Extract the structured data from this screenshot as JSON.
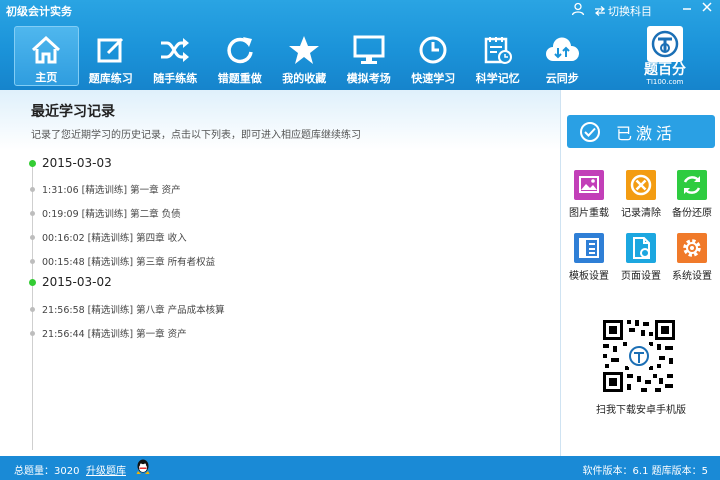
{
  "titlebar": {
    "app_title": "初级会计实务",
    "switch_subject": "切换科目",
    "user_icon": "user-icon",
    "buttons": [
      "minimize-icon",
      "close-icon"
    ]
  },
  "nav": {
    "active_color": "#3aa9e8",
    "items": [
      {
        "label": "主页",
        "icon": "home-icon"
      },
      {
        "label": "题库练习",
        "icon": "edit-icon"
      },
      {
        "label": "随手练练",
        "icon": "shuffle-icon"
      },
      {
        "label": "错题重做",
        "icon": "refresh-icon"
      },
      {
        "label": "我的收藏",
        "icon": "star-icon"
      },
      {
        "label": "模拟考场",
        "icon": "monitor-icon"
      },
      {
        "label": "快速学习",
        "icon": "clock-icon"
      },
      {
        "label": "科学记忆",
        "icon": "calendar-icon"
      },
      {
        "label": "云同步",
        "icon": "cloud-sync-icon"
      }
    ]
  },
  "logo": {
    "name": "题百分",
    "sub": "TI100.com"
  },
  "main": {
    "title": "最近学习记录",
    "subtitle": "记录了您近期学习的历史记录，点击以下列表，即可进入相应题库继续练习",
    "groups": [
      {
        "date": "2015-03-03",
        "records": [
          "1:31:06 [精选训练] 第一章 资产",
          "0:19:09 [精选训练] 第二章 负债",
          "00:16:02 [精选训练] 第四章 收入",
          "00:15:48 [精选训练] 第三章 所有者权益"
        ]
      },
      {
        "date": "2015-03-02",
        "records": [
          "21:56:58 [精选训练] 第八章 产品成本核算",
          "21:56:44 [精选训练] 第一章 资产"
        ]
      }
    ]
  },
  "side": {
    "activated_label": "已激活",
    "tools": [
      {
        "label": "图片重载",
        "icon": "image-icon",
        "color": "#c23fb8"
      },
      {
        "label": "记录清除",
        "icon": "clear-icon",
        "color": "#f39c12"
      },
      {
        "label": "备份还原",
        "icon": "backup-restore-icon",
        "color": "#2ecc40"
      },
      {
        "label": "模板设置",
        "icon": "template-icon",
        "color": "#2f7fd6"
      },
      {
        "label": "页面设置",
        "icon": "page-settings-icon",
        "color": "#1ca7e0"
      },
      {
        "label": "系统设置",
        "icon": "gear-icon",
        "color": "#f07a2a"
      }
    ],
    "qr_label": "扫我下载安卓手机版"
  },
  "status": {
    "total": "总题量：3020",
    "upgrade": "升级题库",
    "version": "软件版本：6.1  题库版本：5"
  }
}
